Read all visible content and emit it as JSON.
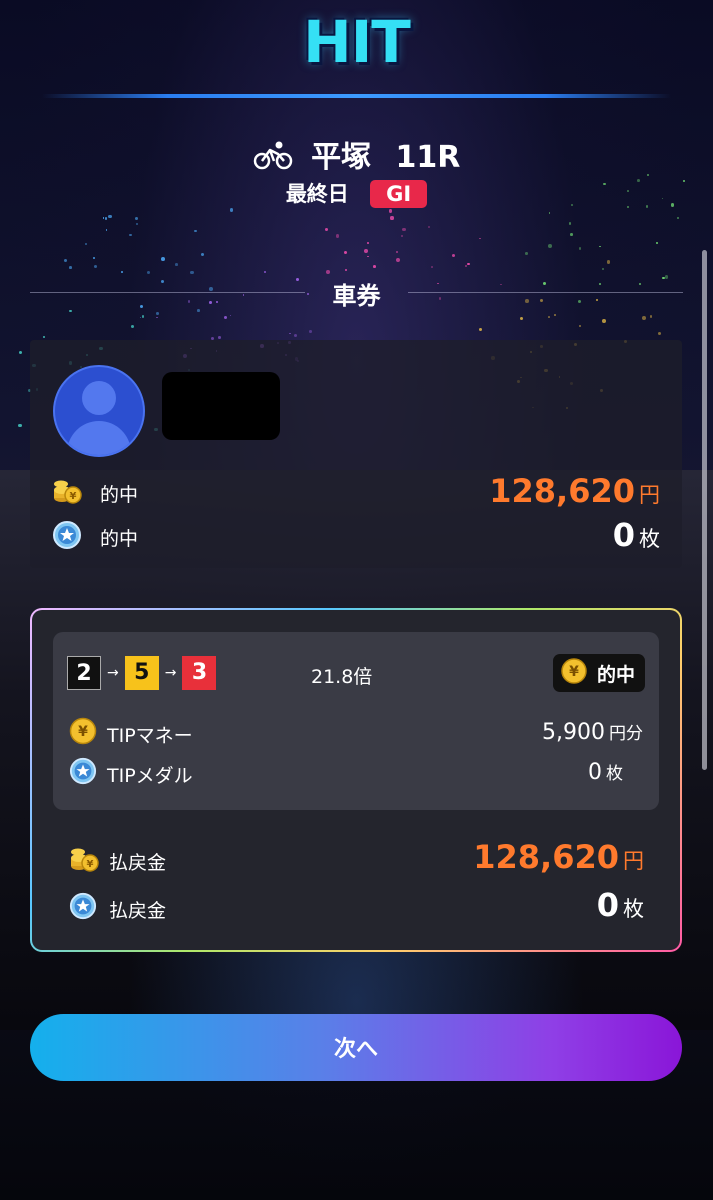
{
  "header": {
    "logo_text": "HIT"
  },
  "race": {
    "venue": "平塚",
    "race_number": "11R",
    "day_label": "最終日",
    "grade": "GI"
  },
  "section_title": "車券",
  "user": {
    "rows": [
      {
        "icon": "gold-coins-icon",
        "label": "的中",
        "value": "128,620",
        "unit": "円",
        "color": "#ff7a2d"
      },
      {
        "icon": "star-medal-icon",
        "label": "的中",
        "value": "0",
        "unit": "枚",
        "color": "#ffffff"
      }
    ]
  },
  "ticket": {
    "combo": [
      "2",
      "5",
      "3"
    ],
    "combo_colors": [
      "#111111",
      "#f7c21b",
      "#e8303a"
    ],
    "arrow": "→",
    "odds": "21.8倍",
    "badge_coin": "¥",
    "badge_label": "的中",
    "rows": [
      {
        "icon": "yen-coin-icon",
        "label": "TIPマネー",
        "value": "5,900",
        "unit": "円分"
      },
      {
        "icon": "star-medal-icon",
        "label": "TIPメダル",
        "value": "0",
        "unit": "枚"
      }
    ],
    "payout": [
      {
        "icon": "gold-coins-icon",
        "label": "払戻金",
        "value": "128,620",
        "unit": "円",
        "color": "#ff7a2d"
      },
      {
        "icon": "star-medal-icon",
        "label": "払戻金",
        "value": "0",
        "unit": "枚",
        "color": "#ffffff"
      }
    ]
  },
  "next_button": {
    "label": "次へ"
  }
}
